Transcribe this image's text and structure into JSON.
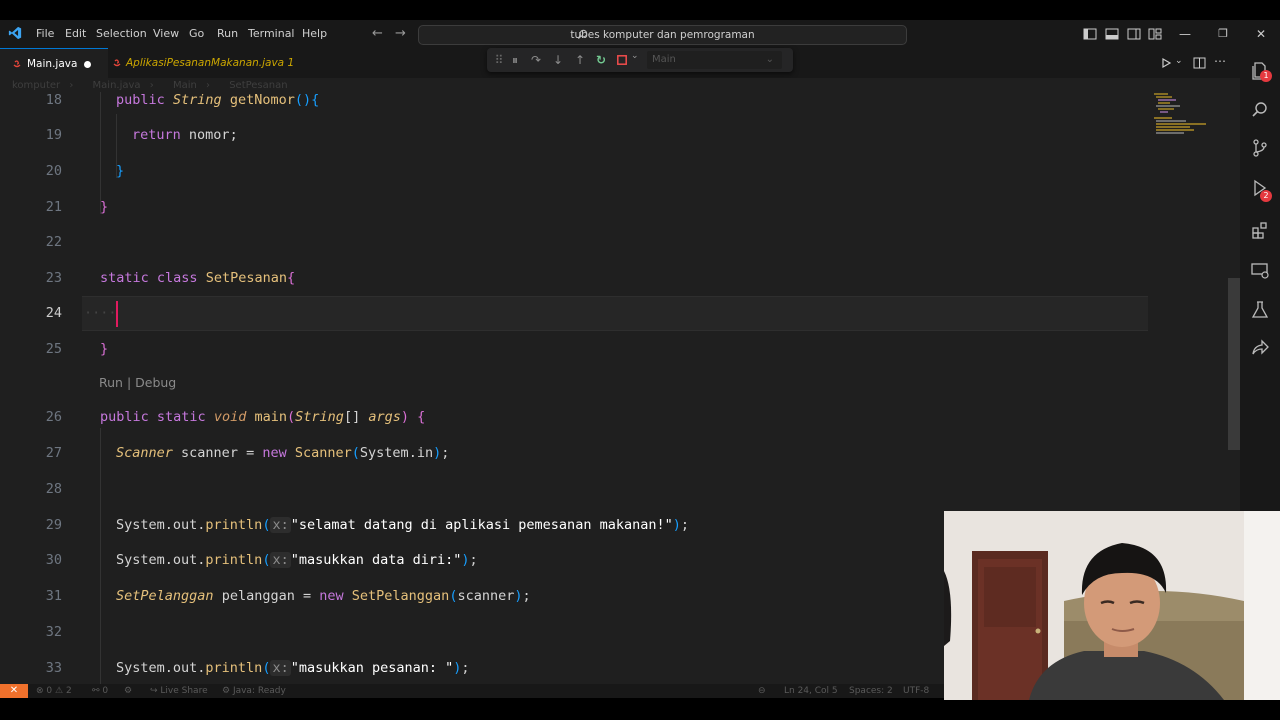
{
  "menu": {
    "file": "File",
    "edit": "Edit",
    "selection": "Selection",
    "view": "View",
    "go": "Go",
    "run": "Run",
    "terminal": "Terminal",
    "help": "Help"
  },
  "command_center": {
    "text": "tubes komputer dan pemrograman"
  },
  "tabs": [
    {
      "label": "Main.java",
      "active": true,
      "dirty": true
    },
    {
      "label": "AplikasiPesananMakanan.java 1",
      "active": false
    }
  ],
  "debug_toolbar": {
    "config": "Main"
  },
  "breadcrumbs": {
    "folder": "komputer",
    "file": "Main.java",
    "class": "Main",
    "inner": "SetPesanan"
  },
  "code": {
    "lines": [
      {
        "no": "18",
        "text": "public String getNomor(){"
      },
      {
        "no": "19",
        "text": "return nomor;"
      },
      {
        "no": "20",
        "text": "}"
      },
      {
        "no": "21",
        "text": "}"
      },
      {
        "no": "22",
        "text": ""
      },
      {
        "no": "23",
        "text": "static class SetPesanan{"
      },
      {
        "no": "24",
        "text": ""
      },
      {
        "no": "25",
        "text": "}"
      },
      {
        "no": "26",
        "text": "public static void main(String[] args) {"
      },
      {
        "no": "27",
        "text": "Scanner scanner = new Scanner(System.in);"
      },
      {
        "no": "28",
        "text": ""
      },
      {
        "no": "29",
        "text": "System.out.println(x:\"selamat datang di aplikasi pemesanan makanan!\");"
      },
      {
        "no": "30",
        "text": "System.out.println(x:\"masukkan data diri:\");"
      },
      {
        "no": "31",
        "text": "SetPelanggan pelanggan = new SetPelanggan(scanner);"
      },
      {
        "no": "32",
        "text": ""
      },
      {
        "no": "33",
        "text": "System.out.println(x:\"masukkan pesanan: \");"
      }
    ],
    "tokens": {
      "public": "public",
      "static": "static",
      "class": "class",
      "void": "void",
      "new": "new",
      "return": "return",
      "string": "String",
      "get_nomor": "getNomor",
      "nomor": "nomor",
      "set_pesanan": "SetPesanan",
      "main": "main",
      "args": "args",
      "scanner_type": "Scanner",
      "scanner_var": "scanner",
      "system_in": "System.in",
      "system_out": "System.out.",
      "println": "println",
      "hint_x": "x:",
      "str_welcome": "\"selamat datang di aplikasi pemesanan makanan!\"",
      "str_data_diri": "\"masukkan data diri:\"",
      "str_pesanan": "\"masukkan pesanan: \"",
      "set_pelanggan": "SetPelanggan",
      "pelanggan": "pelanggan"
    },
    "codelens": "Run | Debug"
  },
  "statusbar": {
    "errors": "0",
    "warnings": "2",
    "ports": "0",
    "live_share": "Live Share",
    "java_status": "Java: Ready",
    "position": "Ln 24, Col 5",
    "spaces": "Spaces: 2",
    "encoding": "UTF-8"
  },
  "activity_badges": {
    "explorer": "1",
    "run_debug": "2"
  },
  "colors": {
    "editor_bg": "#1f1f1f",
    "keyword": "#c678dd",
    "type": "#e5c07b",
    "cursor": "#e01b5f",
    "remote": "#f0712c"
  }
}
